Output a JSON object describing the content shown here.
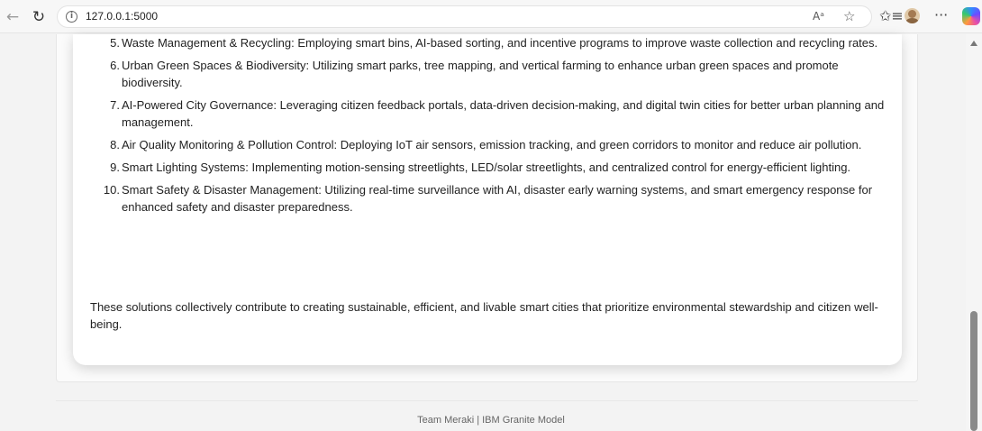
{
  "browser": {
    "url": "127.0.0.1:5000",
    "info_icon": "i",
    "read_aloud_icon": "Aᵃ",
    "more_icon": "···"
  },
  "content": {
    "items": [
      {
        "number": "5.",
        "text": "Waste Management & Recycling: Employing smart bins, AI-based sorting, and incentive programs to improve waste collection and recycling rates."
      },
      {
        "number": "6.",
        "text": "Urban Green Spaces & Biodiversity: Utilizing smart parks, tree mapping, and vertical farming to enhance urban green spaces and promote biodiversity."
      },
      {
        "number": "7.",
        "text": "AI-Powered City Governance: Leveraging citizen feedback portals, data-driven decision-making, and digital twin cities for better urban planning and management."
      },
      {
        "number": "8.",
        "text": "Air Quality Monitoring & Pollution Control: Deploying IoT air sensors, emission tracking, and green corridors to monitor and reduce air pollution."
      },
      {
        "number": "9.",
        "text": "Smart Lighting Systems: Implementing motion-sensing streetlights, LED/solar streetlights, and centralized control for energy-efficient lighting."
      },
      {
        "number": "10.",
        "text": "Smart Safety & Disaster Management: Utilizing real-time surveillance with AI, disaster early warning systems, and smart emergency response for enhanced safety and disaster preparedness."
      }
    ],
    "summary": "These solutions collectively contribute to creating sustainable, efficient, and livable smart cities that prioritize environmental stewardship and citizen well-being."
  },
  "footer": {
    "text": "Team Meraki | IBM Granite Model"
  }
}
